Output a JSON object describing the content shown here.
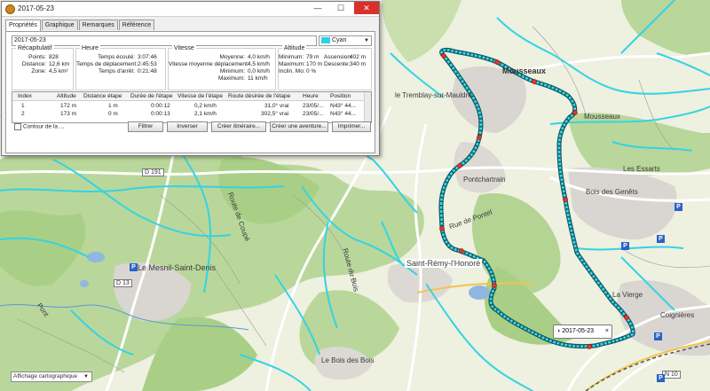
{
  "window": {
    "title": "2017-05-23",
    "minimize_glyph": "—",
    "maximize_glyph": "☐",
    "close_glyph": "✕"
  },
  "tabs": [
    {
      "label": "Propriétés",
      "active": true
    },
    {
      "label": "Graphique",
      "active": false
    },
    {
      "label": "Remarques",
      "active": false
    },
    {
      "label": "Référence",
      "active": false
    }
  ],
  "track": {
    "name": "2017-05-23",
    "color_label": "Cyan",
    "color_hex": "#2ed1e0"
  },
  "groups": {
    "recap": {
      "title": "Récapitulatif",
      "rows": [
        {
          "k": "Points:",
          "v": "828"
        },
        {
          "k": "Distance:",
          "v": "12,6 km"
        },
        {
          "k": "Zone:",
          "v": "4,5 km²"
        }
      ]
    },
    "heure": {
      "title": "Heure",
      "rows": [
        {
          "k": "Temps écoulé:",
          "v": "3:07:46"
        },
        {
          "k": "Temps de déplacement:",
          "v": "2:45:53"
        },
        {
          "k": "Temps d'arrêt:",
          "v": "0:21:48"
        }
      ]
    },
    "vitesse": {
      "title": "Vitesse",
      "rows": [
        {
          "k": "Moyenne:",
          "v": "4,0 km/h"
        },
        {
          "k": "Vitesse moyenne déplacement:",
          "v": "4,5 km/h"
        },
        {
          "k": "Minimum:",
          "v": "0,0 km/h"
        },
        {
          "k": "Maximum:",
          "v": "11 km/h"
        }
      ]
    },
    "altitude": {
      "title": "Altitude",
      "rows": [
        {
          "k": "Minimum:",
          "v": "79 m",
          "k2": "Ascension:",
          "v2": "402 m"
        },
        {
          "k": "Maximum:",
          "v": "170 m",
          "k2": "Descente:",
          "v2": "340 m"
        },
        {
          "k": "Inclin. Mo:",
          "v": "0 %",
          "k2": "",
          "v2": ""
        }
      ]
    }
  },
  "steps_table": {
    "headers": [
      "Index",
      "Altitude",
      "Distance étape",
      "Durée de l'étape",
      "Vitesse de l'étape",
      "Route désirée de l'étape",
      "Heure",
      "Position"
    ],
    "rows": [
      [
        "1",
        "172 m",
        "1 m",
        "0:00:12",
        "0,2 km/h",
        "31,0° vrai",
        "23/05/...",
        "N43° 44..."
      ],
      [
        "2",
        "173 m",
        "0 m",
        "0:00:13",
        "2,1 km/h",
        "302,5° vrai",
        "23/05/...",
        "N43° 44..."
      ]
    ]
  },
  "contour_label": "Contour de la ...",
  "buttons": {
    "filtre": "Filtrer",
    "inverser": "Inverser",
    "creer_itineraire": "Créer itinéraire...",
    "creer_aventure": "Créer une aventure...",
    "imprimer": "Imprimer..."
  },
  "map": {
    "labels": {
      "mousseaux": "Mousseaux",
      "mousseaux2": "Mousseaux",
      "tremblay": "le Tremblay-sur-Mauldre",
      "pontchartrain": "Pontchartrain",
      "saint_remy": "Saint-Rémy-l'Honoré",
      "le_mesnil": "Le Mesnil-Saint-Denis",
      "coignieres": "Coignières",
      "bois_fonds": "Le Bois des Bois",
      "rue_pontel": "Rue de Pontel",
      "bois_dec": "Bois des Genêts",
      "la_vierge": "La Vierge",
      "route_coupe": "Route de Coupé",
      "les_essarts": "Les Essarts",
      "route_bois": "Route du Bois",
      "pont": "Pont"
    },
    "road_shields": {
      "d191": "D 191",
      "d13": "D 13",
      "n10": "N 10"
    },
    "poi_letter": "P",
    "track_label": "2017-05-23",
    "layer_select": "Affichage cartographique"
  }
}
